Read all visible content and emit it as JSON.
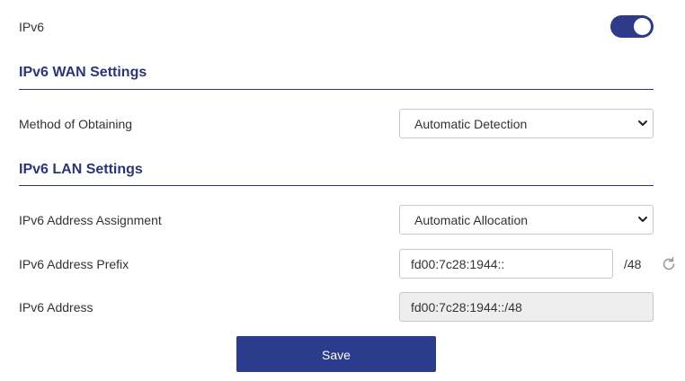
{
  "ipv6": {
    "label": "IPv6",
    "enabled": true
  },
  "wan": {
    "title": "IPv6 WAN Settings",
    "method": {
      "label": "Method of Obtaining",
      "value": "Automatic Detection"
    }
  },
  "lan": {
    "title": "IPv6 LAN Settings",
    "assignment": {
      "label": "IPv6 Address Assignment",
      "value": "Automatic Allocation"
    },
    "prefix": {
      "label": "IPv6 Address Prefix",
      "value": "fd00:7c28:1944::",
      "suffix": "/48"
    },
    "address": {
      "label": "IPv6 Address",
      "value": "fd00:7c28:1944::/48"
    }
  },
  "actions": {
    "save_label": "Save"
  },
  "colors": {
    "accent": "#2c3c8c",
    "heading": "#2c3677",
    "readonly_bg": "#eeeeee"
  },
  "icons": {
    "select_arrow": "chevron-down-icon",
    "refresh": "refresh-icon"
  }
}
